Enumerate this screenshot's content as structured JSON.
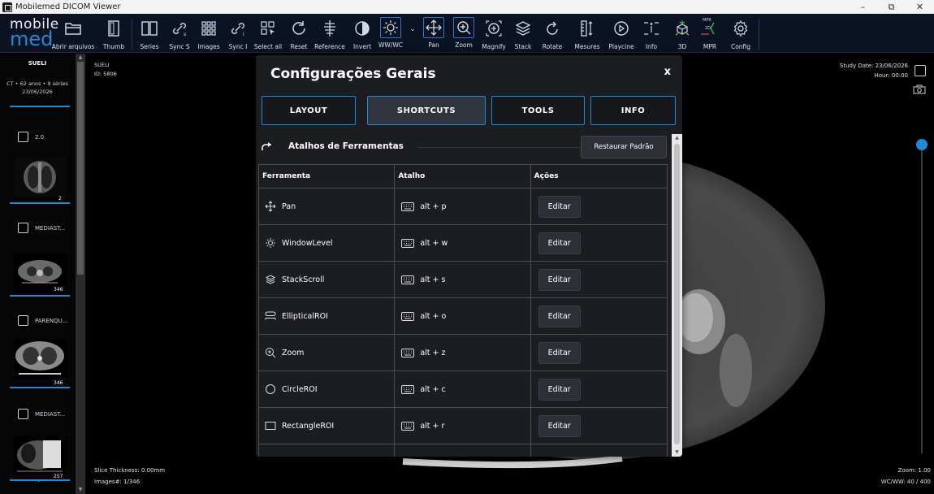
{
  "window": {
    "title": "Mobilemed DICOM Viewer",
    "minimize": "–",
    "maximize": "⧉",
    "close": "✕"
  },
  "logo": {
    "line1": "mobile",
    "line2": "med"
  },
  "toolbar": {
    "items": [
      {
        "label": "Abrir arquivos"
      },
      {
        "label": "Thumb"
      },
      {
        "label": "Series"
      },
      {
        "label": "Sync S"
      },
      {
        "label": "Images"
      },
      {
        "label": "Sync I"
      },
      {
        "label": "Select all"
      },
      {
        "label": "Reset"
      },
      {
        "label": "Reference"
      },
      {
        "label": "Invert"
      },
      {
        "label": "WW/WC"
      },
      {
        "label": "Pan"
      },
      {
        "label": "Zoom"
      },
      {
        "label": "Magnify"
      },
      {
        "label": "Stack"
      },
      {
        "label": "Rotate"
      },
      {
        "label": "Mesures"
      },
      {
        "label": "Playcine"
      },
      {
        "label": "Info"
      },
      {
        "label": "3D"
      },
      {
        "label": "MPR"
      },
      {
        "label": "Config"
      }
    ],
    "mpr_top": "MPR",
    "mpr_2d": "2D"
  },
  "left_panel": {
    "patient": "SUELI",
    "meta": "CT • 62 anos • 9 séries",
    "date": "23/06/2026",
    "series": [
      {
        "label": "2.0",
        "count": "2"
      },
      {
        "label": "MEDIAST...",
        "count": "346"
      },
      {
        "label": "PARENQU...",
        "count": "346"
      },
      {
        "label": "MEDIAST...",
        "count": "257"
      }
    ]
  },
  "viewport": {
    "patient": "SUELI",
    "id": "ID: 5806",
    "study_date": "Study Date: 23/06/2026",
    "hour": "Hour: 00:00",
    "slice": "Slice Thickness: 0.00mm",
    "images": "Images#: 1/346",
    "zoom": "Zoom: 1.00",
    "wcww": "WC/WW: 40 / 400"
  },
  "modal": {
    "title": "Configurações Gerais",
    "close": "x",
    "tabs": [
      {
        "label": "LAYOUT"
      },
      {
        "label": "SHORTCUTS"
      },
      {
        "label": "TOOLS"
      },
      {
        "label": "INFO"
      }
    ],
    "section_title": "Atalhos de Ferramentas",
    "restore": "Restaurar Padrão",
    "headers": [
      "Ferramenta",
      "Atalho",
      "Ações"
    ],
    "rows": [
      {
        "tool": "Pan",
        "icon": "pan-icon",
        "shortcut": "alt + p",
        "action": "Editar"
      },
      {
        "tool": "WindowLevel",
        "icon": "window-level-icon",
        "shortcut": "alt + w",
        "action": "Editar"
      },
      {
        "tool": "StackScroll",
        "icon": "stack-icon",
        "shortcut": "alt + s",
        "action": "Editar"
      },
      {
        "tool": "EllipticalROI",
        "icon": "ellipse-icon",
        "shortcut": "alt + o",
        "action": "Editar"
      },
      {
        "tool": "Zoom",
        "icon": "zoom-icon",
        "shortcut": "alt + z",
        "action": "Editar"
      },
      {
        "tool": "CircleROI",
        "icon": "circle-icon",
        "shortcut": "alt + c",
        "action": "Editar"
      },
      {
        "tool": "RectangleROI",
        "icon": "rectangle-icon",
        "shortcut": "alt + r",
        "action": "Editar"
      }
    ]
  },
  "colors": {
    "accent": "#1f8ad6",
    "toolbar_bg": "#0b1322",
    "modal_bg": "#1b1d21"
  }
}
